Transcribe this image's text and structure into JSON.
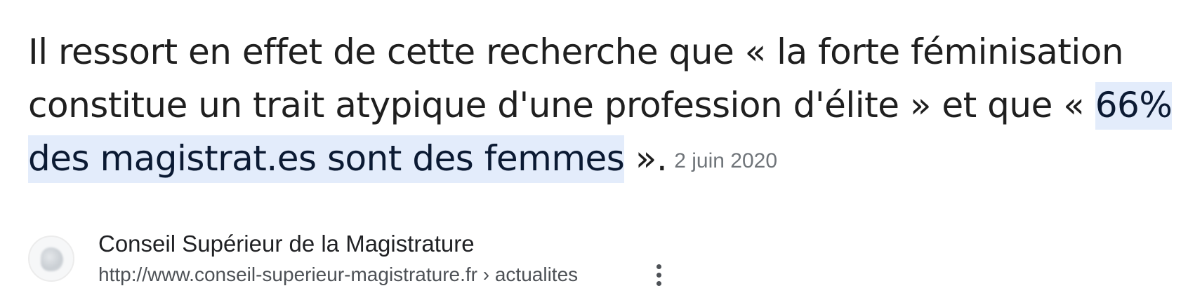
{
  "snippet": {
    "text_before": "Il ressort en effet de cette recherche que « la forte féminisation constitue un trait atypique d'une profession d'élite » et que « ",
    "highlight": "66% des magistrat.es sont des femmes",
    "text_after": " ».",
    "date": "2 juin 2020",
    "highlight_color": "#e3ecfb"
  },
  "source": {
    "name": "Conseil Supérieur de la Magistrature",
    "url": "http://www.conseil-superieur-magistrature.fr › actualites",
    "favicon_icon": "site-favicon-icon",
    "menu_icon": "more-vert-icon"
  }
}
